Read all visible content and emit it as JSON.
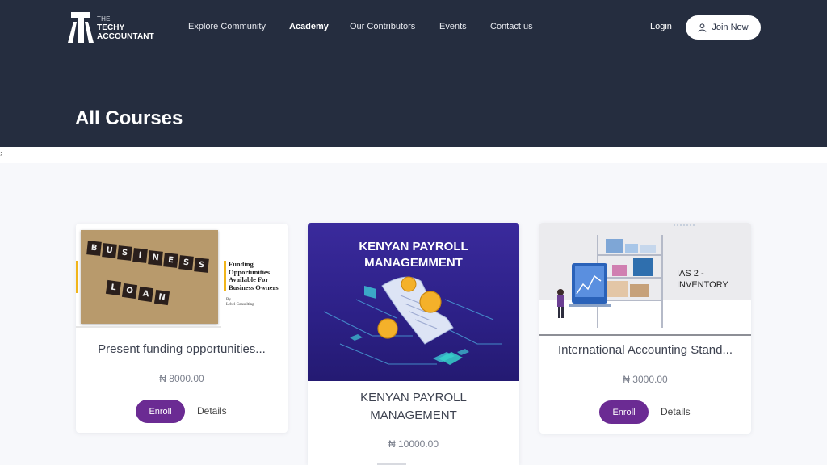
{
  "brand": {
    "line1": "THE",
    "line2": "TECHY",
    "line3": "ACCOUNTANT",
    "icon": "ta-logo-mark"
  },
  "nav": {
    "items": [
      {
        "label": "Explore Community",
        "active": false
      },
      {
        "label": "Academy",
        "active": true
      },
      {
        "label": "Our Contributors",
        "active": false
      },
      {
        "label": "Events",
        "active": false
      },
      {
        "label": "Contact us",
        "active": false
      }
    ],
    "login_label": "Login",
    "join_label": "Join Now",
    "join_icon": "user-icon"
  },
  "hero": {
    "title": "All Courses"
  },
  "stray_mark": ";",
  "courses": [
    {
      "title": "Present funding opportunities...",
      "price": "₦ 8000.00",
      "enroll_label": "Enroll",
      "details_label": "Details",
      "image": {
        "tiles_row1": [
          "B",
          "U",
          "S",
          "I",
          "N",
          "E",
          "S",
          "S"
        ],
        "tiles_row2": [
          "L",
          "O",
          "A",
          "N"
        ],
        "side_text": "Funding Opportunities Available For Business Owners",
        "by_text": "By",
        "by_name": "Lebel Consulting"
      }
    },
    {
      "title": "KENYAN PAYROLL MANAGEMENT",
      "price": "₦ 10000.00",
      "image": {
        "heading_line1": "KENYAN PAYROLL",
        "heading_line2": "MANAGEMMENT"
      }
    },
    {
      "title": "International Accounting Stand...",
      "price": "₦ 3000.00",
      "enroll_label": "Enroll",
      "details_label": "Details",
      "image": {
        "label_line1": "IAS 2 -",
        "label_line2": "INVENTORY"
      }
    }
  ],
  "colors": {
    "hero_bg": "#252d3f",
    "accent_purple": "#6b2b93",
    "page_bg": "#f7f8fb",
    "payroll_bg": "#2c2086",
    "gold": "#f1b51a"
  }
}
